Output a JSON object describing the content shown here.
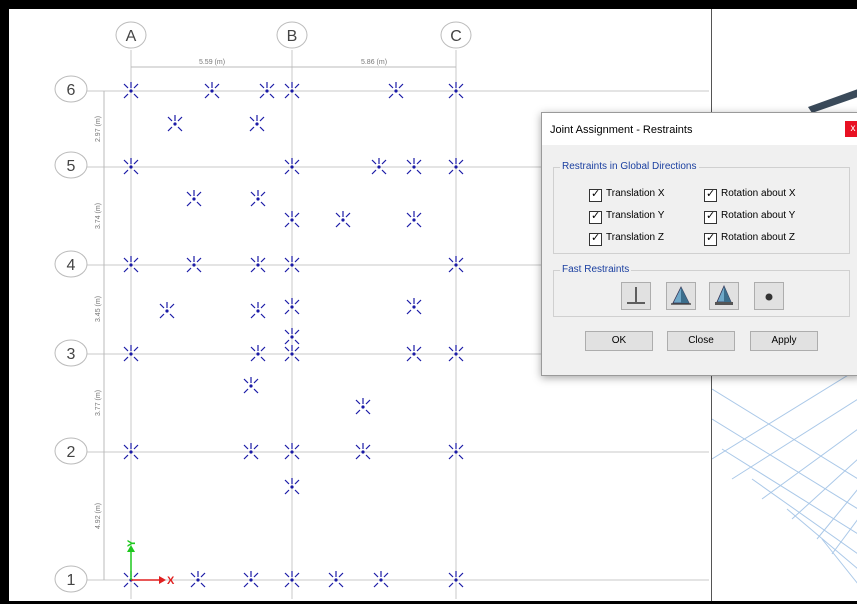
{
  "dialog": {
    "title": "Joint Assignment - Restraints",
    "close_glyph": "x",
    "restraints_group": {
      "legend": "Restraints in Global Directions",
      "options": [
        {
          "label": "Translation  X",
          "checked": true
        },
        {
          "label": "Rotation about  X",
          "checked": true
        },
        {
          "label": "Translation  Y",
          "checked": true
        },
        {
          "label": "Rotation about  Y",
          "checked": true
        },
        {
          "label": "Translation  Z",
          "checked": true
        },
        {
          "label": "Rotation about  Z",
          "checked": true
        }
      ]
    },
    "fast_group": {
      "legend": "Fast Restraints",
      "buttons": [
        "free-restraint-icon",
        "pinned-restraint-icon",
        "fixed-restraint-icon",
        "roller-restraint-icon"
      ]
    },
    "buttons": {
      "ok": "OK",
      "close": "Close",
      "apply": "Apply"
    }
  },
  "plan": {
    "column_grid_labels": [
      "A",
      "B",
      "C"
    ],
    "row_grid_labels": [
      "6",
      "5",
      "4",
      "3",
      "2",
      "1"
    ],
    "column_spacings": [
      "5.59 (m)",
      "5.86 (m)"
    ],
    "row_spacings": [
      "2.97 (m)",
      "3.74 (m)",
      "3.45 (m)",
      "3.77 (m)",
      "4.92 (m)"
    ],
    "axis_labels": {
      "x": "X",
      "y": "Y"
    },
    "joint_color": "#1a1aa6",
    "grid_color": "#c8c8c8",
    "x_axis_color": "#e02020",
    "y_axis_color": "#1ec81e"
  }
}
